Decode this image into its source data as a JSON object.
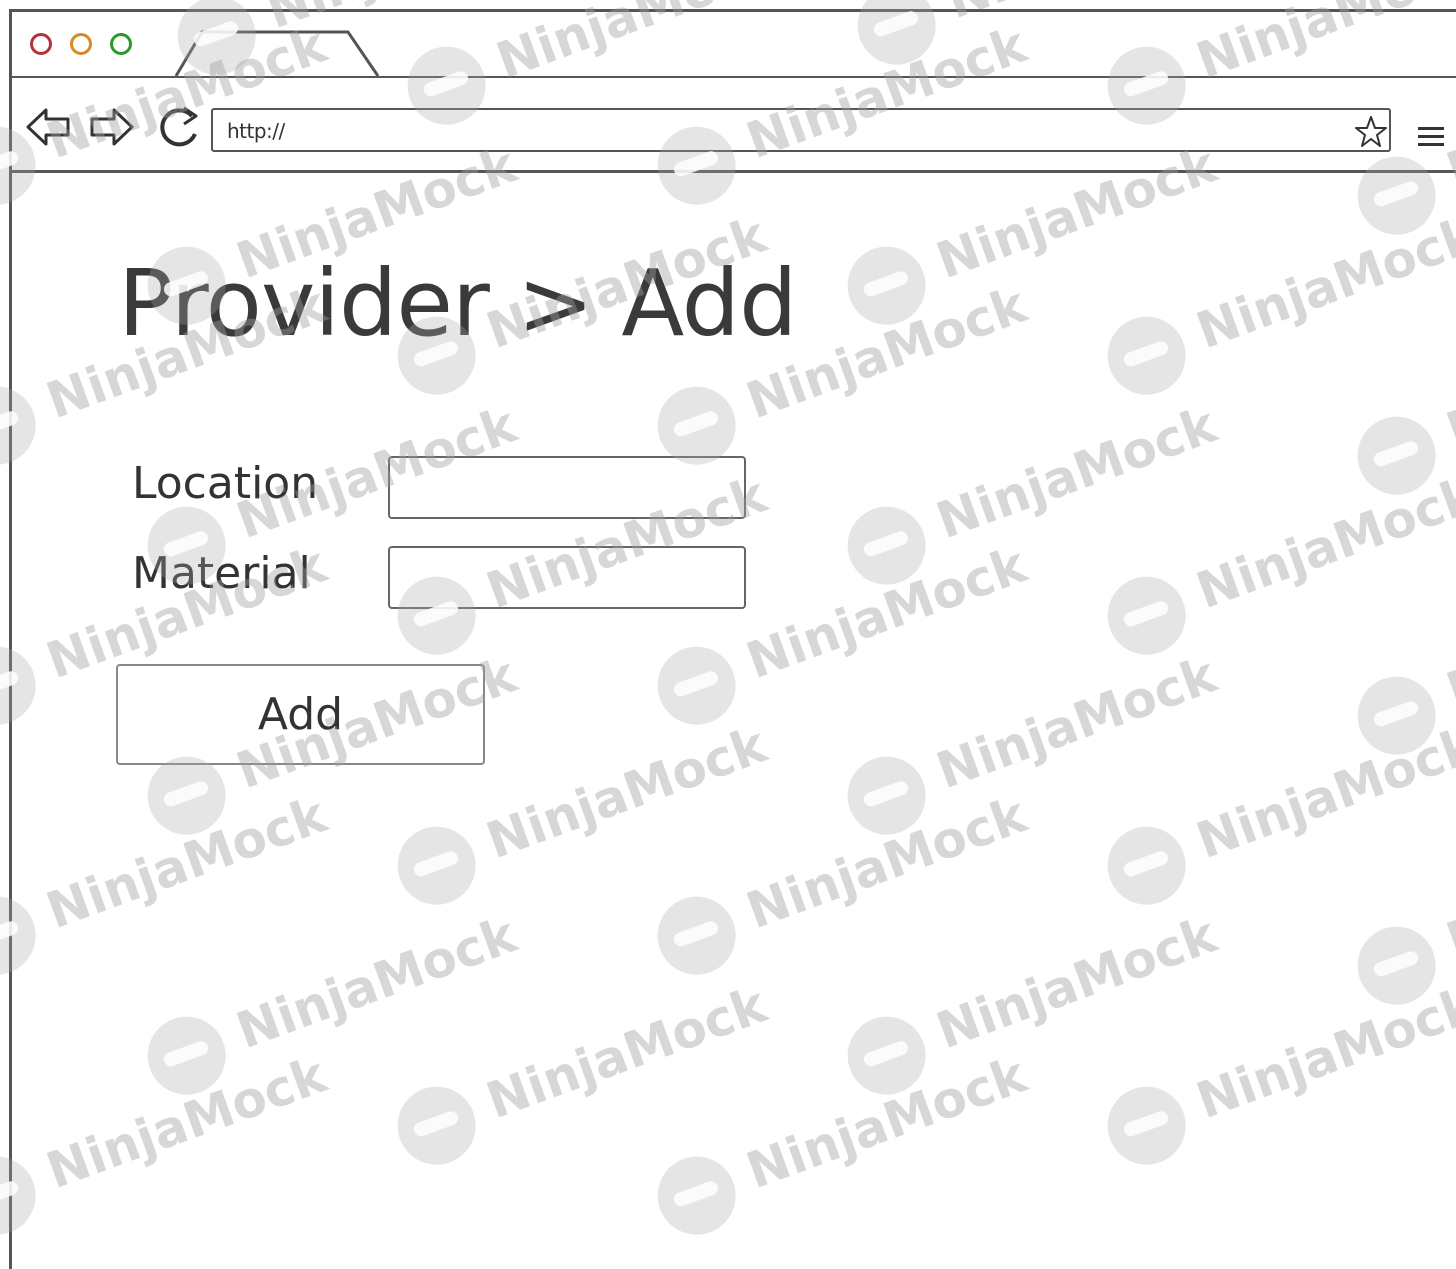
{
  "browser": {
    "address_bar": "http://",
    "traffic_lights": {
      "close_color": "#b4333a",
      "minimize_color": "#d98a20",
      "maximize_color": "#2a9a2a"
    },
    "icons": {
      "back": "back-arrow-icon",
      "forward": "forward-arrow-icon",
      "reload": "reload-icon",
      "bookmark": "star-icon",
      "menu": "hamburger-menu-icon"
    }
  },
  "page": {
    "title": "Provider > Add",
    "form": {
      "location_label": "Location",
      "location_value": "",
      "material_label": "Material",
      "material_value": ""
    },
    "add_button_label": "Add"
  },
  "watermark": {
    "text": "NinjaMock"
  }
}
